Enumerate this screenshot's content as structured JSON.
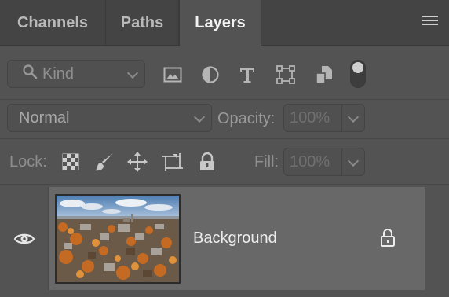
{
  "tabs": [
    {
      "label": "Channels",
      "active": false
    },
    {
      "label": "Paths",
      "active": false
    },
    {
      "label": "Layers",
      "active": true
    }
  ],
  "filter": {
    "kind_label": "Kind",
    "icons": [
      "image-filter-icon",
      "adjustment-filter-icon",
      "type-filter-icon",
      "shape-filter-icon",
      "smart-object-filter-icon"
    ],
    "toggle_on": true
  },
  "blend": {
    "mode": "Normal",
    "opacity_label": "Opacity:",
    "opacity_value": "100%"
  },
  "lock": {
    "label": "Lock:",
    "icons": [
      "lock-transparent-pixels-icon",
      "lock-image-pixels-icon",
      "lock-position-icon",
      "lock-artboard-icon",
      "lock-all-icon"
    ],
    "fill_label": "Fill:",
    "fill_value": "100%"
  },
  "layers": [
    {
      "name": "Background",
      "visible": true,
      "locked": true
    }
  ],
  "colors": {
    "panel_bg": "#535353",
    "tab_bar_bg": "#444444",
    "selected_layer_bg": "#686868"
  }
}
